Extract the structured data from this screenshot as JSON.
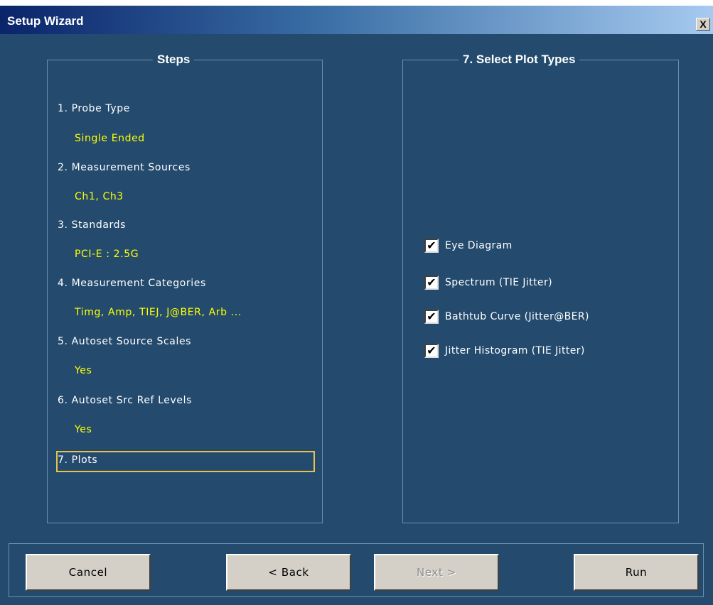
{
  "window": {
    "title": "Setup Wizard",
    "close_glyph": "X"
  },
  "steps_panel": {
    "legend": "Steps",
    "items": [
      {
        "label": "1. Probe Type",
        "value": "Single Ended"
      },
      {
        "label": "2. Measurement Sources",
        "value": "Ch1, Ch3"
      },
      {
        "label": "3. Standards",
        "value": "PCI-E : 2.5G"
      },
      {
        "label": "4. Measurement Categories",
        "value": "Timg, Amp, TIEJ, J@BER, Arb ..."
      },
      {
        "label": "5. Autoset Source Scales",
        "value": "Yes"
      },
      {
        "label": "6. Autoset Src Ref Levels",
        "value": "Yes"
      },
      {
        "label": "7. Plots",
        "value": ""
      }
    ],
    "active_step": 7
  },
  "plot_panel": {
    "legend": "7. Select Plot Types",
    "options": [
      {
        "label": "Eye Diagram",
        "checked": true
      },
      {
        "label": "Spectrum (TIE Jitter)",
        "checked": true
      },
      {
        "label": "Bathtub Curve (Jitter@BER)",
        "checked": true
      },
      {
        "label": "Jitter Histogram (TIE Jitter)",
        "checked": true
      }
    ]
  },
  "buttons": {
    "cancel": "Cancel",
    "back": "< Back",
    "next": "Next >",
    "next_enabled": false,
    "run": "Run"
  },
  "colors": {
    "background": "#244b6e",
    "step_value": "#ffff00",
    "active_highlight": "#e8c24a"
  }
}
